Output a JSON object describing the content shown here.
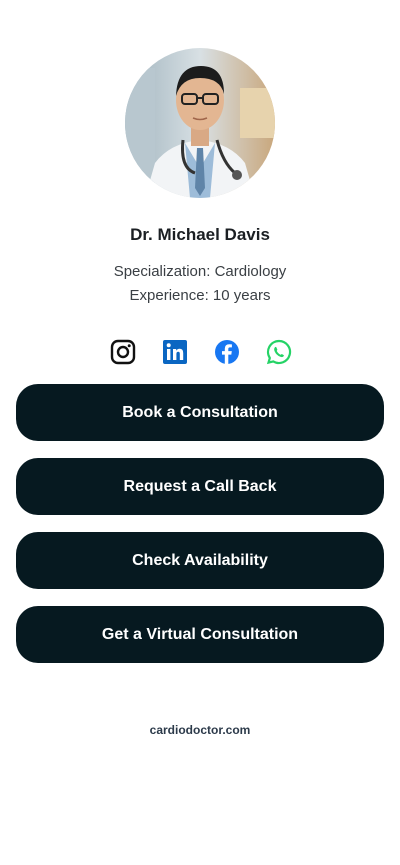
{
  "profile": {
    "name": "Dr. Michael Davis",
    "specialization": "Specialization: Cardiology",
    "experience": "Experience: 10 years"
  },
  "socials": [
    {
      "icon": "instagram-icon",
      "color": "#111111"
    },
    {
      "icon": "linkedin-icon",
      "color": "#0a66c2"
    },
    {
      "icon": "facebook-icon",
      "color": "#1877f2"
    },
    {
      "icon": "whatsapp-icon",
      "color": "#25d366"
    }
  ],
  "actions": {
    "book": "Book a Consultation",
    "callback": "Request a Call Back",
    "availability": "Check Availability",
    "virtual": "Get a Virtual Consultation"
  },
  "footer": {
    "website": "cardiodoctor.com"
  },
  "colors": {
    "button_bg": "#061920",
    "button_text": "#ffffff"
  }
}
